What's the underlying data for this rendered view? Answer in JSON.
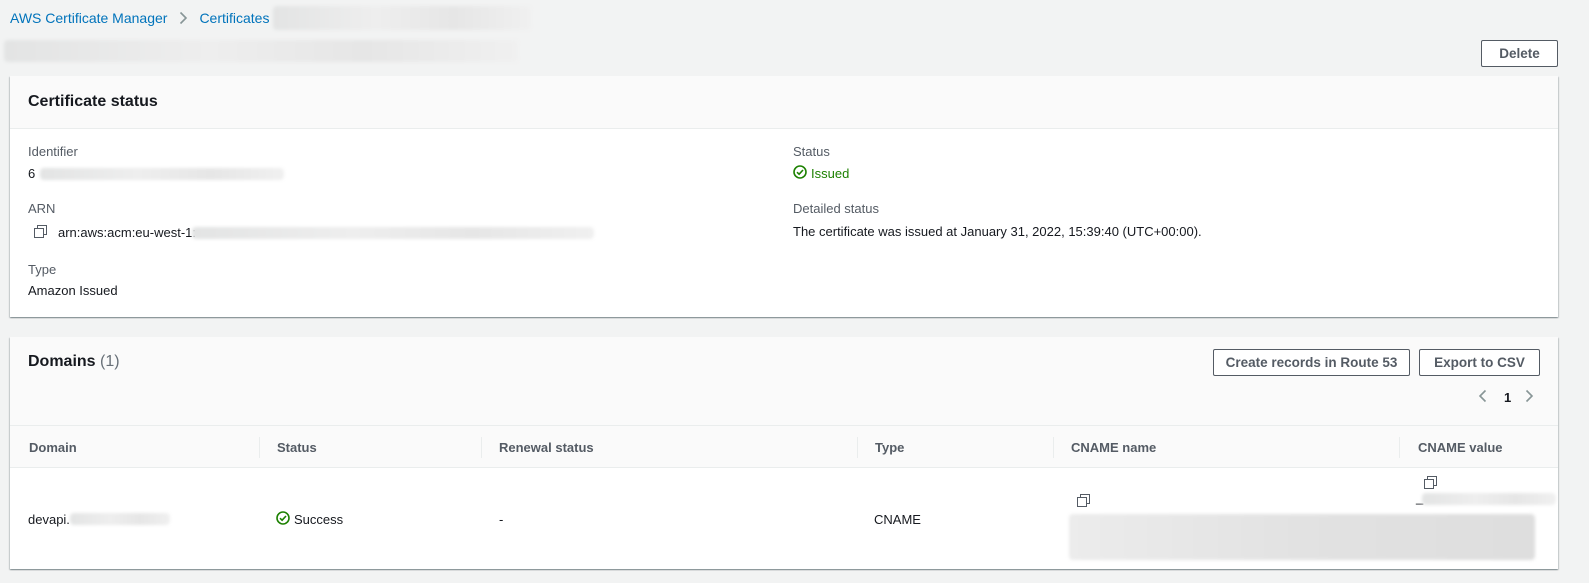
{
  "breadcrumb": {
    "items": [
      {
        "label": "AWS Certificate Manager"
      },
      {
        "label": "Certificates"
      }
    ]
  },
  "header": {
    "delete_label": "Delete"
  },
  "certificate_status": {
    "title": "Certificate status",
    "identifier": {
      "label": "Identifier",
      "value": "6"
    },
    "arn": {
      "label": "ARN",
      "value": "arn:aws:acm:eu-west-1:"
    },
    "type": {
      "label": "Type",
      "value": "Amazon Issued"
    },
    "status": {
      "label": "Status",
      "value": "Issued"
    },
    "detailed_status": {
      "label": "Detailed status",
      "value": "The certificate was issued at January 31, 2022, 15:39:40 (UTC+00:00)."
    }
  },
  "domains": {
    "title": "Domains",
    "count": "(1)",
    "create_records_label": "Create records in Route 53",
    "export_label": "Export to CSV",
    "page": "1",
    "columns": [
      "Domain",
      "Status",
      "Renewal status",
      "Type",
      "CNAME name",
      "CNAME value"
    ],
    "rows": [
      {
        "domain": "devapi.",
        "status": "Success",
        "renewal_status": "-",
        "type": "CNAME",
        "cname_value_prefix": "_"
      }
    ]
  },
  "colors": {
    "link": "#0073bb",
    "success": "#1d8102",
    "background": "#f2f3f3"
  }
}
